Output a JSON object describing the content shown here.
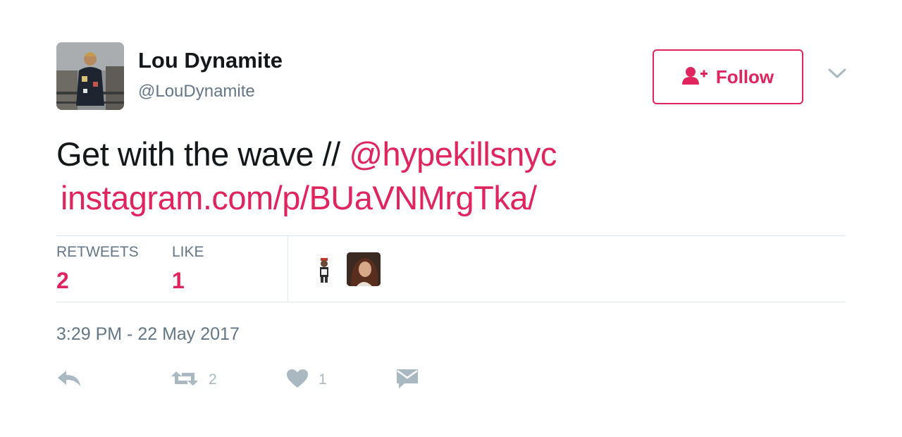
{
  "tweet": {
    "author": {
      "display_name": "Lou Dynamite",
      "handle": "@LouDynamite"
    },
    "follow_button_label": "Follow",
    "text": "Get with the wave // ",
    "mention": "@hypekillsnyc",
    "link": "instagram.com/p/BUaVNMrgTka/",
    "stats": {
      "retweets_label": "RETWEETS",
      "retweets_value": "2",
      "likes_label": "LIKE",
      "likes_value": "1"
    },
    "timestamp": "3:29 PM - 22 May 2017",
    "actions": {
      "retweet_count": "2",
      "like_count": "1"
    }
  },
  "colors": {
    "accent": "#e0245e",
    "secondary_text": "#657786",
    "icon_gray": "#aab8c2",
    "divider": "#e1e8ed"
  },
  "icons": {
    "follow": "follow-person-plus-icon",
    "more": "chevron-down-icon",
    "reply": "reply-arrow-icon",
    "retweet": "retweet-icon",
    "like": "heart-icon",
    "dm": "envelope-icon"
  }
}
